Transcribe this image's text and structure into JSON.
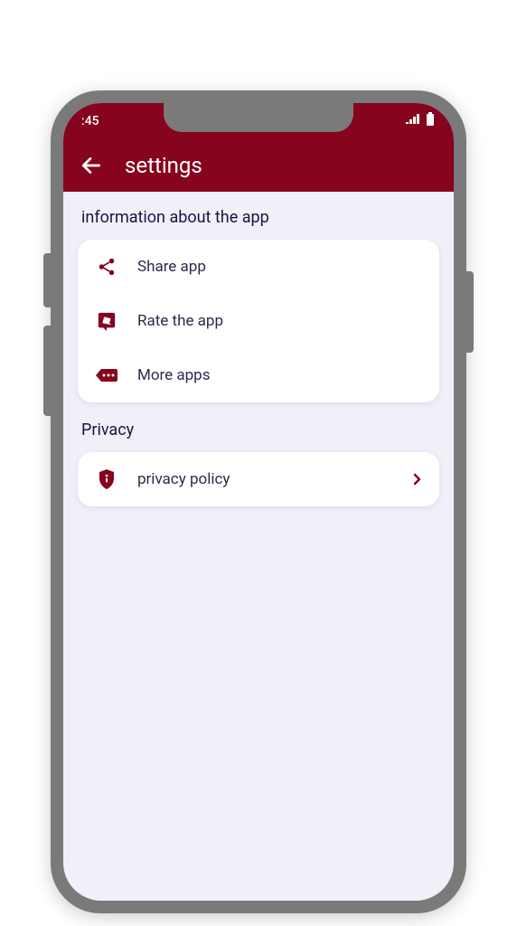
{
  "statusBar": {
    "time": ":45"
  },
  "appBar": {
    "title": "settings"
  },
  "sections": {
    "info": {
      "title": "information about the app",
      "items": {
        "share": "Share app",
        "rate": "Rate the app",
        "more": "More apps"
      }
    },
    "privacy": {
      "title": "Privacy",
      "items": {
        "policy": "privacy policy"
      }
    }
  },
  "colors": {
    "primary": "#86041e",
    "text": "#2d2a4a",
    "bg": "#f2eff9"
  }
}
